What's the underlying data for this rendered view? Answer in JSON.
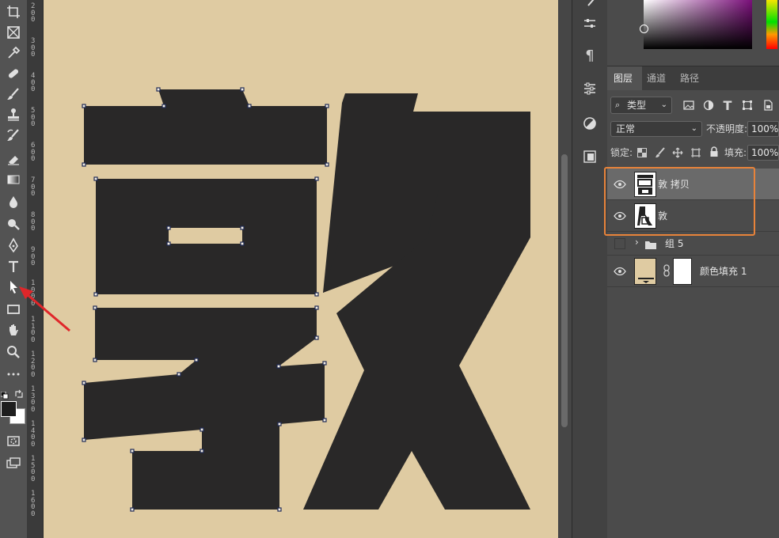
{
  "toolbar": {
    "tools": [
      "crop-icon",
      "frame-icon",
      "eyedropper-icon",
      "healing-brush-icon",
      "brush-icon",
      "stamp-icon",
      "history-brush-icon",
      "eraser-icon",
      "gradient-icon",
      "blur-icon",
      "dodge-icon",
      "pen-icon",
      "type-icon",
      "path-selection-icon",
      "rectangle-icon",
      "hand-icon",
      "zoom-icon",
      "more-tools-icon",
      "swap-colors-icon",
      "default-colors-icon",
      "quick-mask-icon",
      "screen-mode-icon"
    ],
    "active_tool": "path-selection-icon"
  },
  "ruler": {
    "marks": [
      "2\n0\n0",
      "3\n0\n0",
      "4\n0\n0",
      "5\n0\n0",
      "6\n0\n0",
      "7\n0\n0",
      "8\n0\n0",
      "9\n0\n0",
      "1\n0\n0\n0",
      "1\n1\n0\n0",
      "1\n2\n0\n0",
      "1\n3\n0\n0",
      "1\n4\n0\n0",
      "1\n5\n0\n0",
      "1\n6\n0\n0"
    ]
  },
  "canvas": {
    "background_color": "#dfcba2",
    "glyph_color": "#292828",
    "anchor_color": "#1f2a55"
  },
  "panel": {
    "tabs": [
      "图层",
      "通道",
      "路径"
    ],
    "active_tab": "图层",
    "filter_kind": "类型",
    "blend_mode": "正常",
    "opacity_label": "不透明度:",
    "opacity_value": "100%",
    "lock_label": "锁定:",
    "fill_label": "填充:",
    "fill_value": "100%",
    "layers": [
      {
        "name": "敦 拷贝",
        "visible": true,
        "selected": true
      },
      {
        "name": "敦",
        "visible": true,
        "selected": false
      },
      {
        "name": "组 5",
        "visible": false,
        "selected": false,
        "type": "group"
      },
      {
        "name": "颜色填充 1",
        "visible": true,
        "selected": false,
        "type": "fill"
      }
    ]
  },
  "colors": {
    "highlight": "#e8833a",
    "arrow": "#e0262a"
  }
}
